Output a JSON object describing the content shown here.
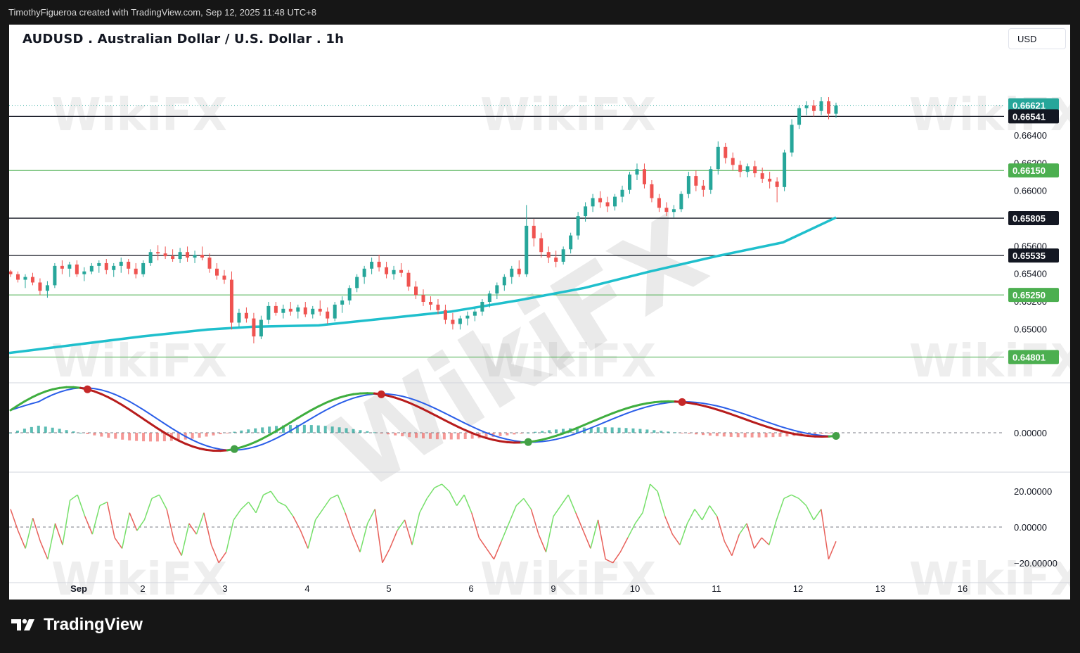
{
  "header": {
    "credit": "TimothyFigueroa created with TradingView.com, Sep 12, 2025 11:48 UTC+8"
  },
  "chart": {
    "title": "AUDUSD . Australian Dollar / U.S. Dollar . 1h",
    "currency_button": "USD"
  },
  "footer": {
    "brand": "TradingView"
  },
  "watermark": {
    "text": "WikiFX"
  },
  "colors": {
    "up": "#26a69a",
    "down": "#ef5350",
    "ema": "#1fbfcc",
    "support_green": "#4caf50",
    "price_teal": "#26a69a",
    "macd_signal_blue": "#2a5ee8",
    "macd_line_green": "#3fae3f",
    "macd_line_red": "#b71c1c",
    "momentum_up": "#76e06a",
    "momentum_down": "#e8605a"
  },
  "chart_data": {
    "type": "candlestick",
    "symbol": "AUDUSD",
    "timeframe": "1h",
    "x_labels": [
      "Sep",
      "2",
      "3",
      "4",
      "5",
      "6",
      "9",
      "10",
      "11",
      "12",
      "13",
      "16"
    ],
    "price_axis": {
      "ticks": [
        "0.66400",
        "0.66200",
        "0.66000",
        "0.65600",
        "0.65400",
        "0.65200",
        "0.65000"
      ],
      "tick_values": [
        0.664,
        0.662,
        0.66,
        0.656,
        0.654,
        0.652,
        0.65
      ],
      "ylim": [
        0.6462,
        0.6696
      ]
    },
    "last_price": {
      "value": 0.66621,
      "label": "0.66621"
    },
    "horizontal_levels": [
      {
        "value": 0.66541,
        "label": "0.66541",
        "style": "black"
      },
      {
        "value": 0.6615,
        "label": "0.66150",
        "style": "green"
      },
      {
        "value": 0.65805,
        "label": "0.65805",
        "style": "black"
      },
      {
        "value": 0.65535,
        "label": "0.65535",
        "style": "black"
      },
      {
        "value": 0.6525,
        "label": "0.65250",
        "style": "green"
      },
      {
        "value": 0.64801,
        "label": "0.64801",
        "style": "green"
      }
    ],
    "ema_path": [
      [
        0,
        0.6483
      ],
      [
        15,
        0.6489
      ],
      [
        30,
        0.6495
      ],
      [
        45,
        0.65
      ],
      [
        55,
        0.6502
      ],
      [
        70,
        0.6503
      ],
      [
        85,
        0.6508
      ],
      [
        100,
        0.6513
      ],
      [
        115,
        0.6521
      ],
      [
        130,
        0.653
      ],
      [
        145,
        0.6542
      ],
      [
        160,
        0.6553
      ],
      [
        175,
        0.6563
      ],
      [
        187,
        0.6581
      ]
    ],
    "candles": [
      [
        0.6542,
        0.6543,
        0.6538,
        0.654
      ],
      [
        0.654,
        0.6542,
        0.6534,
        0.6536
      ],
      [
        0.6536,
        0.654,
        0.653,
        0.6538
      ],
      [
        0.6538,
        0.6541,
        0.6532,
        0.6534
      ],
      [
        0.6534,
        0.6537,
        0.6525,
        0.6528
      ],
      [
        0.6528,
        0.6535,
        0.6523,
        0.6532
      ],
      [
        0.6532,
        0.6548,
        0.653,
        0.6546
      ],
      [
        0.6546,
        0.655,
        0.654,
        0.6544
      ],
      [
        0.6544,
        0.6549,
        0.6538,
        0.6547
      ],
      [
        0.6547,
        0.655,
        0.6538,
        0.654
      ],
      [
        0.654,
        0.6545,
        0.6535,
        0.6542
      ],
      [
        0.6542,
        0.6548,
        0.654,
        0.6546
      ],
      [
        0.6546,
        0.655,
        0.6541,
        0.6548
      ],
      [
        0.6548,
        0.6551,
        0.654,
        0.6543
      ],
      [
        0.6543,
        0.6548,
        0.6538,
        0.6546
      ],
      [
        0.6546,
        0.6552,
        0.6541,
        0.6549
      ],
      [
        0.6549,
        0.6551,
        0.654,
        0.6544
      ],
      [
        0.6544,
        0.6548,
        0.6537,
        0.654
      ],
      [
        0.654,
        0.655,
        0.6538,
        0.6548
      ],
      [
        0.6548,
        0.6558,
        0.6546,
        0.6556
      ],
      [
        0.6556,
        0.6561,
        0.655,
        0.6555
      ],
      [
        0.6555,
        0.656,
        0.6551,
        0.6553
      ],
      [
        0.6553,
        0.6558,
        0.6549,
        0.6551
      ],
      [
        0.6551,
        0.6559,
        0.6548,
        0.6556
      ],
      [
        0.6556,
        0.656,
        0.6549,
        0.6552
      ],
      [
        0.6552,
        0.6557,
        0.6548,
        0.6554
      ],
      [
        0.6554,
        0.656,
        0.655,
        0.6552
      ],
      [
        0.6552,
        0.6555,
        0.6541,
        0.6544
      ],
      [
        0.6544,
        0.6548,
        0.6536,
        0.6539
      ],
      [
        0.6539,
        0.6543,
        0.6533,
        0.6536
      ],
      [
        0.6536,
        0.6542,
        0.65,
        0.6505
      ],
      [
        0.6505,
        0.6515,
        0.6502,
        0.6512
      ],
      [
        0.6512,
        0.6516,
        0.6505,
        0.6508
      ],
      [
        0.6508,
        0.6512,
        0.649,
        0.6495
      ],
      [
        0.6495,
        0.651,
        0.6493,
        0.6507
      ],
      [
        0.6507,
        0.652,
        0.6504,
        0.6517
      ],
      [
        0.6517,
        0.652,
        0.651,
        0.6512
      ],
      [
        0.6512,
        0.6518,
        0.6508,
        0.6515
      ],
      [
        0.6515,
        0.652,
        0.651,
        0.6513
      ],
      [
        0.6513,
        0.6518,
        0.6508,
        0.6516
      ],
      [
        0.6516,
        0.652,
        0.6509,
        0.6511
      ],
      [
        0.6511,
        0.6517,
        0.6508,
        0.6515
      ],
      [
        0.6515,
        0.6521,
        0.651,
        0.6513
      ],
      [
        0.6513,
        0.6516,
        0.6504,
        0.6508
      ],
      [
        0.6508,
        0.652,
        0.6506,
        0.6518
      ],
      [
        0.6518,
        0.6524,
        0.6512,
        0.6521
      ],
      [
        0.6521,
        0.6532,
        0.6518,
        0.653
      ],
      [
        0.653,
        0.654,
        0.6527,
        0.6538
      ],
      [
        0.6538,
        0.6546,
        0.6533,
        0.6544
      ],
      [
        0.6544,
        0.6552,
        0.654,
        0.6549
      ],
      [
        0.6549,
        0.6554,
        0.6542,
        0.6545
      ],
      [
        0.6545,
        0.6549,
        0.6537,
        0.654
      ],
      [
        0.654,
        0.6546,
        0.6536,
        0.6543
      ],
      [
        0.6543,
        0.6548,
        0.6538,
        0.6541
      ],
      [
        0.6541,
        0.6543,
        0.6528,
        0.6531
      ],
      [
        0.6531,
        0.6535,
        0.6522,
        0.6525
      ],
      [
        0.6525,
        0.6529,
        0.6517,
        0.652
      ],
      [
        0.652,
        0.6524,
        0.6514,
        0.6518
      ],
      [
        0.6518,
        0.6522,
        0.6511,
        0.6514
      ],
      [
        0.6514,
        0.6518,
        0.6504,
        0.6507
      ],
      [
        0.6507,
        0.6512,
        0.65,
        0.6504
      ],
      [
        0.6504,
        0.651,
        0.65,
        0.6508
      ],
      [
        0.6508,
        0.6513,
        0.6503,
        0.651
      ],
      [
        0.651,
        0.6515,
        0.6506,
        0.6513
      ],
      [
        0.6513,
        0.6522,
        0.651,
        0.652
      ],
      [
        0.652,
        0.6528,
        0.6516,
        0.6526
      ],
      [
        0.6526,
        0.6534,
        0.6522,
        0.6532
      ],
      [
        0.6532,
        0.654,
        0.6528,
        0.6538
      ],
      [
        0.6538,
        0.6546,
        0.6533,
        0.6544
      ],
      [
        0.6544,
        0.655,
        0.6538,
        0.654
      ],
      [
        0.654,
        0.659,
        0.6538,
        0.6575
      ],
      [
        0.6575,
        0.658,
        0.656,
        0.6566
      ],
      [
        0.6566,
        0.657,
        0.6552,
        0.6556
      ],
      [
        0.6556,
        0.656,
        0.6548,
        0.6552
      ],
      [
        0.6552,
        0.6557,
        0.6545,
        0.6549
      ],
      [
        0.6549,
        0.656,
        0.6547,
        0.6558
      ],
      [
        0.6558,
        0.657,
        0.6555,
        0.6568
      ],
      [
        0.6568,
        0.6585,
        0.6565,
        0.6582
      ],
      [
        0.6582,
        0.6592,
        0.6578,
        0.6589
      ],
      [
        0.6589,
        0.6598,
        0.6585,
        0.6595
      ],
      [
        0.6595,
        0.66,
        0.6588,
        0.6592
      ],
      [
        0.6592,
        0.6596,
        0.6585,
        0.6589
      ],
      [
        0.6589,
        0.6598,
        0.6586,
        0.6596
      ],
      [
        0.6596,
        0.6604,
        0.6592,
        0.6601
      ],
      [
        0.6601,
        0.6614,
        0.6598,
        0.6612
      ],
      [
        0.6612,
        0.662,
        0.6608,
        0.6616
      ],
      [
        0.6616,
        0.662,
        0.6602,
        0.6605
      ],
      [
        0.6605,
        0.6608,
        0.6592,
        0.6595
      ],
      [
        0.6595,
        0.6598,
        0.6585,
        0.6588
      ],
      [
        0.6588,
        0.6592,
        0.6582,
        0.6585
      ],
      [
        0.6585,
        0.659,
        0.6581,
        0.6587
      ],
      [
        0.6587,
        0.66,
        0.6585,
        0.6598
      ],
      [
        0.6598,
        0.6614,
        0.6595,
        0.6611
      ],
      [
        0.6611,
        0.6615,
        0.66,
        0.6604
      ],
      [
        0.6604,
        0.6608,
        0.6596,
        0.6601
      ],
      [
        0.6601,
        0.6618,
        0.6598,
        0.6616
      ],
      [
        0.6616,
        0.6636,
        0.6612,
        0.6632
      ],
      [
        0.6632,
        0.6635,
        0.662,
        0.6624
      ],
      [
        0.6624,
        0.6628,
        0.6615,
        0.6619
      ],
      [
        0.6619,
        0.6622,
        0.661,
        0.6614
      ],
      [
        0.6614,
        0.662,
        0.661,
        0.6618
      ],
      [
        0.6618,
        0.6622,
        0.661,
        0.6613
      ],
      [
        0.6613,
        0.6617,
        0.6606,
        0.6609
      ],
      [
        0.6609,
        0.6614,
        0.6602,
        0.6607
      ],
      [
        0.6607,
        0.661,
        0.6592,
        0.6603
      ],
      [
        0.6603,
        0.663,
        0.66,
        0.6628
      ],
      [
        0.6628,
        0.6652,
        0.6625,
        0.6648
      ],
      [
        0.6648,
        0.6662,
        0.6645,
        0.666
      ],
      [
        0.666,
        0.6665,
        0.6655,
        0.6662
      ],
      [
        0.6662,
        0.6666,
        0.6654,
        0.6658
      ],
      [
        0.6658,
        0.6668,
        0.6655,
        0.6665
      ],
      [
        0.6665,
        0.6668,
        0.6652,
        0.6656
      ],
      [
        0.6656,
        0.6664,
        0.6653,
        0.6662
      ]
    ],
    "macd_panel": {
      "zero_label": "0.00000",
      "signal_markers": [
        "red",
        "green",
        "red",
        "green",
        "red",
        "green",
        "red",
        "green",
        "red",
        "green",
        "red",
        "green",
        "red",
        "green"
      ]
    },
    "momentum_panel": {
      "ticks": [
        "20.00000",
        "0.00000",
        "−20.00000"
      ],
      "tick_values": [
        20,
        0,
        -20
      ],
      "ylim": [
        -26,
        26
      ],
      "values": [
        10,
        -2,
        -12,
        5,
        -8,
        -18,
        2,
        -10,
        15,
        18,
        6,
        -4,
        12,
        14,
        -6,
        -12,
        8,
        -2,
        4,
        16,
        18,
        10,
        -8,
        -16,
        2,
        -4,
        8,
        -10,
        -20,
        -14,
        4,
        10,
        14,
        8,
        18,
        20,
        14,
        12,
        6,
        -2,
        -12,
        4,
        10,
        16,
        18,
        8,
        -4,
        -14,
        2,
        10,
        -20,
        -12,
        -2,
        4,
        -10,
        8,
        16,
        22,
        24,
        20,
        12,
        18,
        8,
        -6,
        -12,
        -18,
        -8,
        2,
        12,
        16,
        10,
        -4,
        -14,
        6,
        12,
        18,
        8,
        -2,
        -12,
        4,
        -18,
        -20,
        -14,
        -6,
        2,
        8,
        24,
        20,
        6,
        -4,
        -10,
        2,
        10,
        4,
        12,
        6,
        -8,
        -16,
        -4,
        2,
        -12,
        -6,
        -10,
        4,
        16,
        18,
        16,
        12,
        4,
        10,
        -18,
        -8
      ]
    }
  }
}
